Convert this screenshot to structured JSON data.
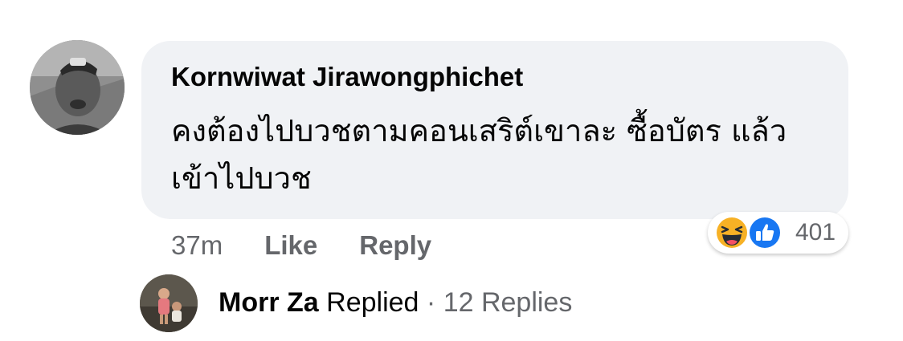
{
  "comment": {
    "author": "Kornwiwat Jirawongphichet",
    "text": "คงต้องไปบวชตามคอนเสริต์เขาละ ซื้อบัตร แล้วเข้าไปบวช",
    "timestamp": "37m",
    "like_label": "Like",
    "reply_label": "Reply",
    "reactions": {
      "icons": [
        "haha-emoji-icon",
        "like-thumb-icon"
      ],
      "count": "401"
    }
  },
  "replies": {
    "replier": "Morr Za",
    "replied_label": "Replied",
    "separator": "·",
    "count_label": "12 Replies"
  },
  "colors": {
    "bubble": "#f0f2f5",
    "secondary_text": "#65676b",
    "like_blue": "#1877f2",
    "haha_yellow": "#f7b125"
  }
}
